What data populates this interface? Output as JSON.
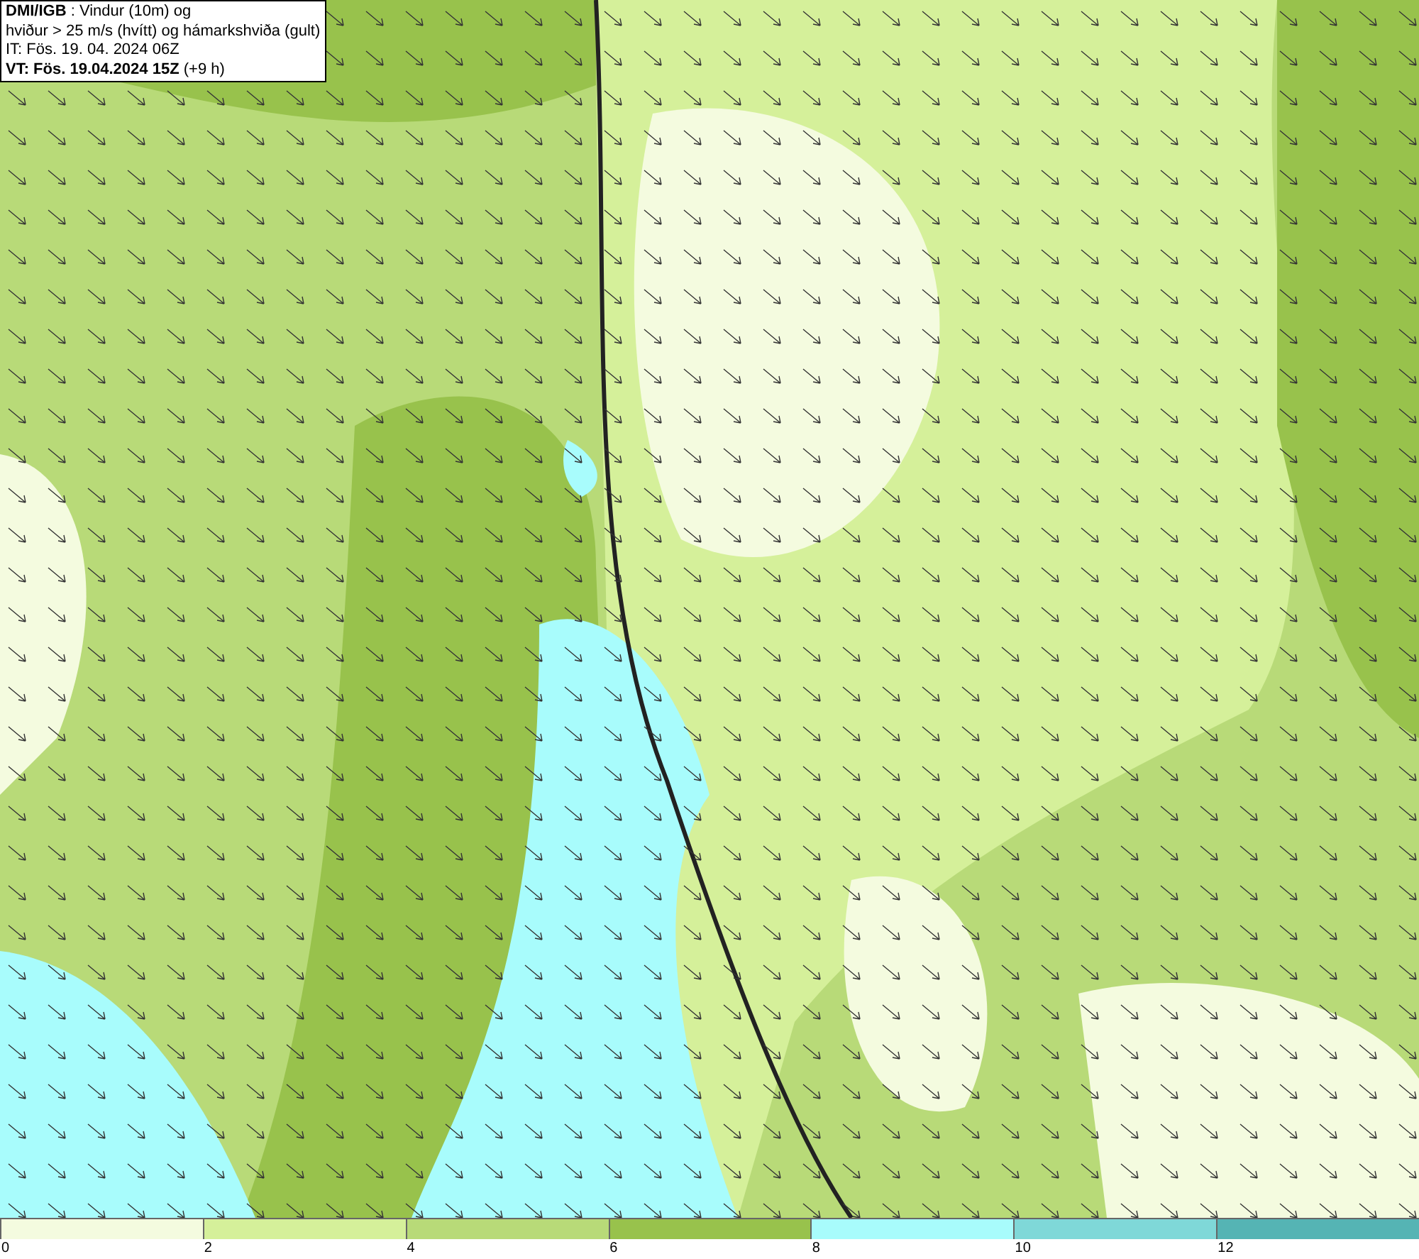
{
  "info_box": {
    "lines": [
      "**DMI/IGB** : Vindur (10m) og",
      "hviður > 25 m/s (hvítt) og hámarkshviða (gult)",
      "IT: Fös. 19. 04. 2024 06Z",
      "**VT: Fös. 19.04.2024 15Z** (+9 h)"
    ]
  },
  "legend": {
    "segments": [
      {
        "label": "0",
        "color": "#f4fbdf"
      },
      {
        "label": "2",
        "color": "#d5f09a"
      },
      {
        "label": "4",
        "color": "#b8da78"
      },
      {
        "label": "6",
        "color": "#98c24c"
      },
      {
        "label": "8",
        "color": "#a8fcfc"
      },
      {
        "label": "10",
        "color": "#7fd8d8"
      },
      {
        "label": "12",
        "color": "#55b4b4"
      }
    ]
  }
}
